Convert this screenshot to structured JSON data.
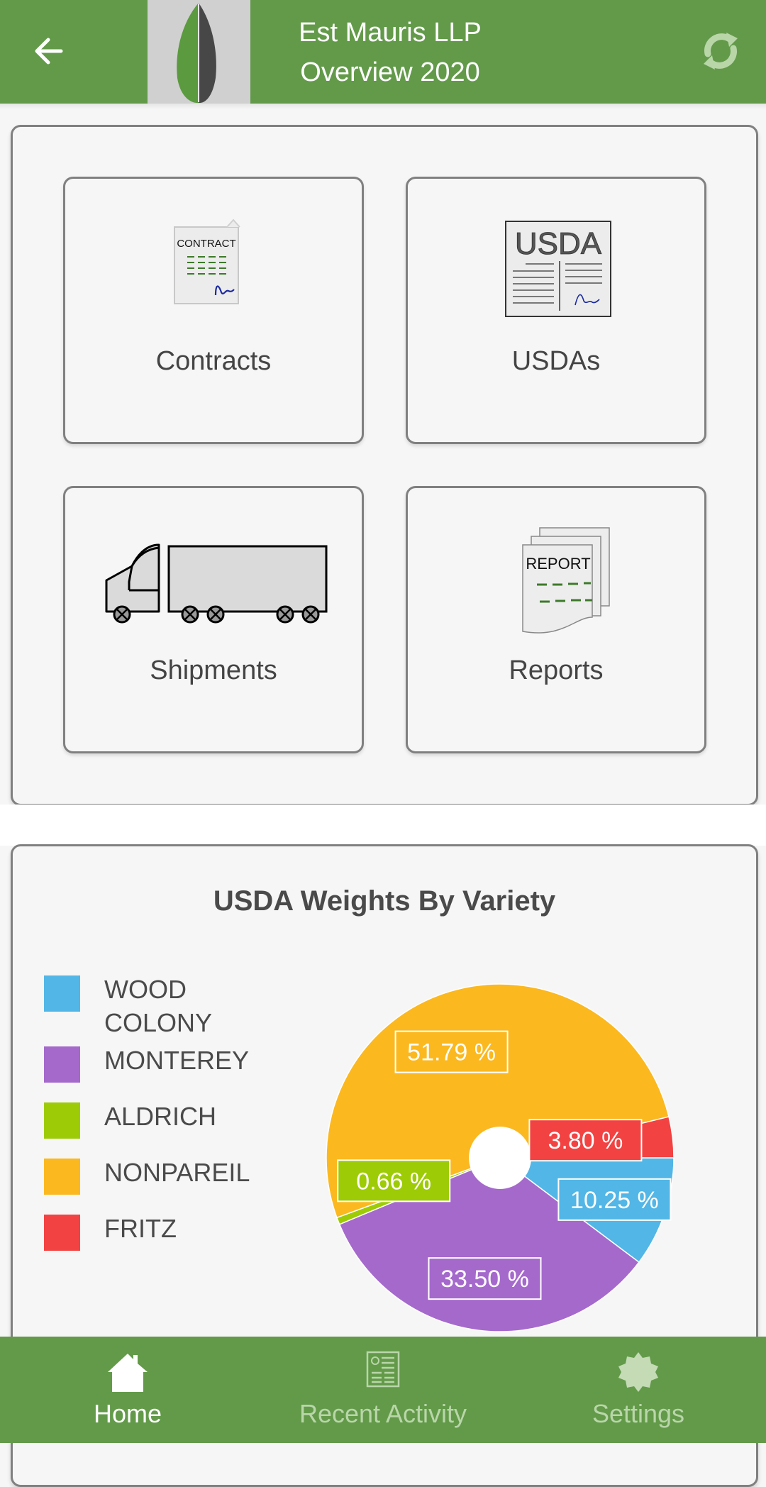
{
  "header": {
    "title_line1": "Est Mauris LLP",
    "title_line2": "Overview 2020",
    "back_icon": "arrow-left-icon",
    "refresh_icon": "refresh-icon",
    "logo": "almond-leaf-logo"
  },
  "tiles": [
    {
      "label": "Contracts",
      "icon": "contract-document-icon",
      "icon_text": "CONTRACT"
    },
    {
      "label": "USDAs",
      "icon": "usda-document-icon",
      "icon_text": "USDA"
    },
    {
      "label": "Shipments",
      "icon": "truck-icon"
    },
    {
      "label": "Reports",
      "icon": "report-stack-icon",
      "icon_text": "REPORT"
    }
  ],
  "colors": {
    "brand_green": "#639a4a",
    "nav_inactive": "#b9d6a9"
  },
  "chart_data": {
    "type": "pie",
    "title": "USDA Weights By Variety",
    "donut": true,
    "legend_position": "left",
    "categories": [
      "WOOD COLONY",
      "MONTEREY",
      "ALDRICH",
      "NONPAREIL",
      "FRITZ"
    ],
    "values": [
      10.25,
      33.5,
      0.66,
      51.79,
      3.8
    ],
    "labels": [
      "10.25 %",
      "33.50 %",
      "0.66 %",
      "51.79 %",
      "3.80 %"
    ],
    "colors": [
      "#52b6e6",
      "#a569cc",
      "#9dcb05",
      "#fbb81f",
      "#f24242"
    ],
    "legend_lines": [
      [
        "WOOD",
        "COLONY"
      ],
      [
        "MONTEREY"
      ],
      [
        "ALDRICH"
      ],
      [
        "NONPAREIL"
      ],
      [
        "FRITZ"
      ]
    ]
  },
  "nav": {
    "items": [
      {
        "label": "Home",
        "icon": "home-icon",
        "active": true
      },
      {
        "label": "Recent Activity",
        "icon": "newspaper-icon",
        "active": false
      },
      {
        "label": "Settings",
        "icon": "settings-badge-icon",
        "active": false
      }
    ]
  }
}
